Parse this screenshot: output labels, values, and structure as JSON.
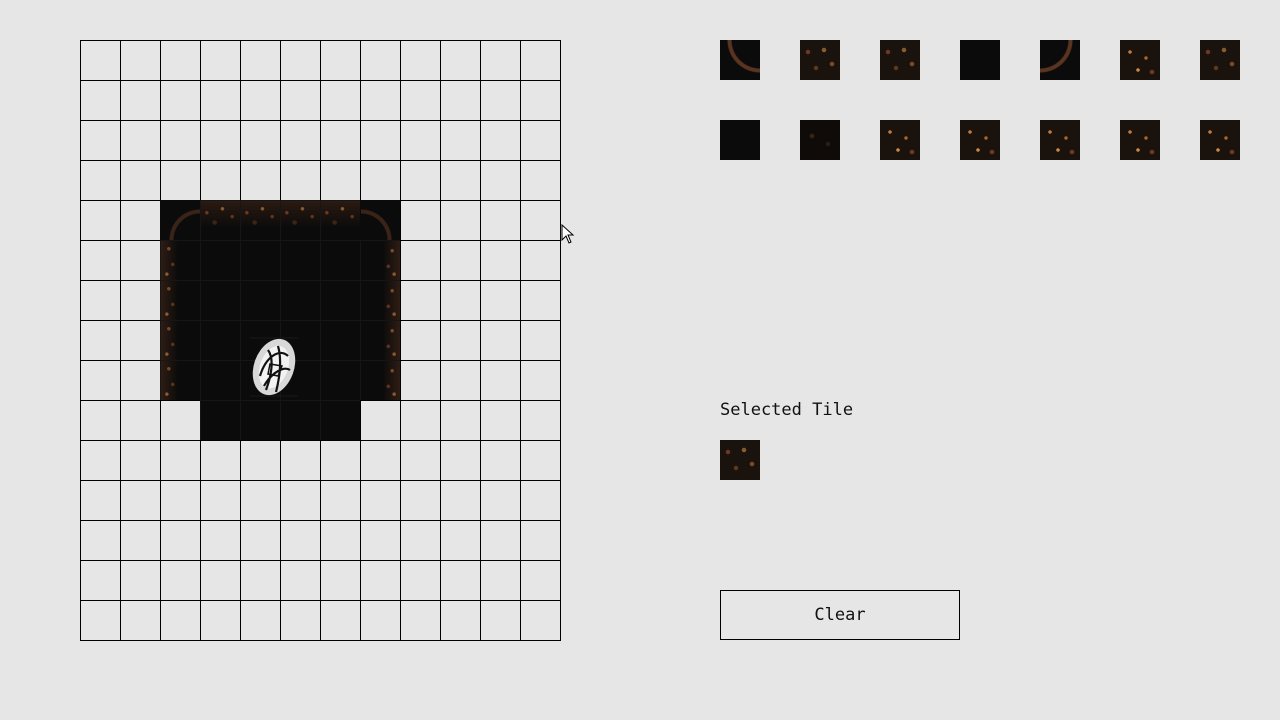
{
  "editor": {
    "grid_columns": 12,
    "grid_rows": 15,
    "map_tiles": [
      {
        "row": 4,
        "col": 2,
        "tile": "corner-tl"
      },
      {
        "row": 4,
        "col": 3,
        "tile": "wall-top"
      },
      {
        "row": 4,
        "col": 4,
        "tile": "wall-top"
      },
      {
        "row": 4,
        "col": 5,
        "tile": "wall-top"
      },
      {
        "row": 4,
        "col": 6,
        "tile": "wall-top"
      },
      {
        "row": 4,
        "col": 7,
        "tile": "corner-tr"
      },
      {
        "row": 5,
        "col": 2,
        "tile": "wall-left"
      },
      {
        "row": 5,
        "col": 3,
        "tile": "floor"
      },
      {
        "row": 5,
        "col": 4,
        "tile": "floor"
      },
      {
        "row": 5,
        "col": 5,
        "tile": "floor"
      },
      {
        "row": 5,
        "col": 6,
        "tile": "floor"
      },
      {
        "row": 5,
        "col": 7,
        "tile": "wall-right"
      },
      {
        "row": 6,
        "col": 2,
        "tile": "wall-left"
      },
      {
        "row": 6,
        "col": 3,
        "tile": "floor"
      },
      {
        "row": 6,
        "col": 4,
        "tile": "floor"
      },
      {
        "row": 6,
        "col": 5,
        "tile": "floor"
      },
      {
        "row": 6,
        "col": 6,
        "tile": "floor"
      },
      {
        "row": 6,
        "col": 7,
        "tile": "wall-right"
      },
      {
        "row": 7,
        "col": 2,
        "tile": "wall-left"
      },
      {
        "row": 7,
        "col": 3,
        "tile": "floor"
      },
      {
        "row": 7,
        "col": 4,
        "tile": "floor"
      },
      {
        "row": 7,
        "col": 5,
        "tile": "floor"
      },
      {
        "row": 7,
        "col": 6,
        "tile": "floor"
      },
      {
        "row": 7,
        "col": 7,
        "tile": "wall-right"
      },
      {
        "row": 8,
        "col": 2,
        "tile": "wall-left"
      },
      {
        "row": 8,
        "col": 3,
        "tile": "floor"
      },
      {
        "row": 8,
        "col": 4,
        "tile": "floor"
      },
      {
        "row": 8,
        "col": 5,
        "tile": "floor"
      },
      {
        "row": 8,
        "col": 6,
        "tile": "floor"
      },
      {
        "row": 8,
        "col": 7,
        "tile": "wall-right"
      },
      {
        "row": 9,
        "col": 3,
        "tile": "floor"
      },
      {
        "row": 9,
        "col": 4,
        "tile": "floor"
      },
      {
        "row": 9,
        "col": 5,
        "tile": "floor"
      },
      {
        "row": 9,
        "col": 6,
        "tile": "floor"
      }
    ],
    "player_sprite": "player-sprite-icon"
  },
  "palette": {
    "rows": [
      [
        "corner-bl",
        "rocky",
        "rocky",
        "dark",
        "corner-br",
        "glow",
        "rocky"
      ],
      [
        "dark",
        "dim",
        "glow",
        "glow",
        "glow",
        "glow",
        "glow"
      ]
    ]
  },
  "selected": {
    "label": "Selected Tile",
    "tile": "rocky"
  },
  "actions": {
    "clear_label": "Clear"
  },
  "colors": {
    "background": "#e6e6e6",
    "grid_line": "#000000",
    "floor": "#0b0b0b",
    "rock_accent": "#8a5a2e"
  }
}
